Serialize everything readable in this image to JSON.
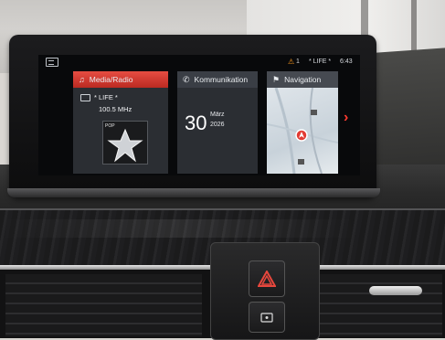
{
  "status_bar": {
    "warning_count": "1",
    "station_indicator": "* LIFE *",
    "time": "6:43"
  },
  "tiles": {
    "media": {
      "title": "Media/Radio",
      "station": "* LIFE *",
      "frequency": "100.5 MHz",
      "cover_tag": "POP"
    },
    "communication": {
      "title": "Kommunikation",
      "day": "30",
      "month": "März",
      "year": "2026"
    },
    "navigation": {
      "title": "Navigation"
    }
  },
  "colors": {
    "accent": "#d8392f",
    "tile_bg": "#2b2e33",
    "screen_bg": "#08090b",
    "warning": "#ff9a1e"
  }
}
